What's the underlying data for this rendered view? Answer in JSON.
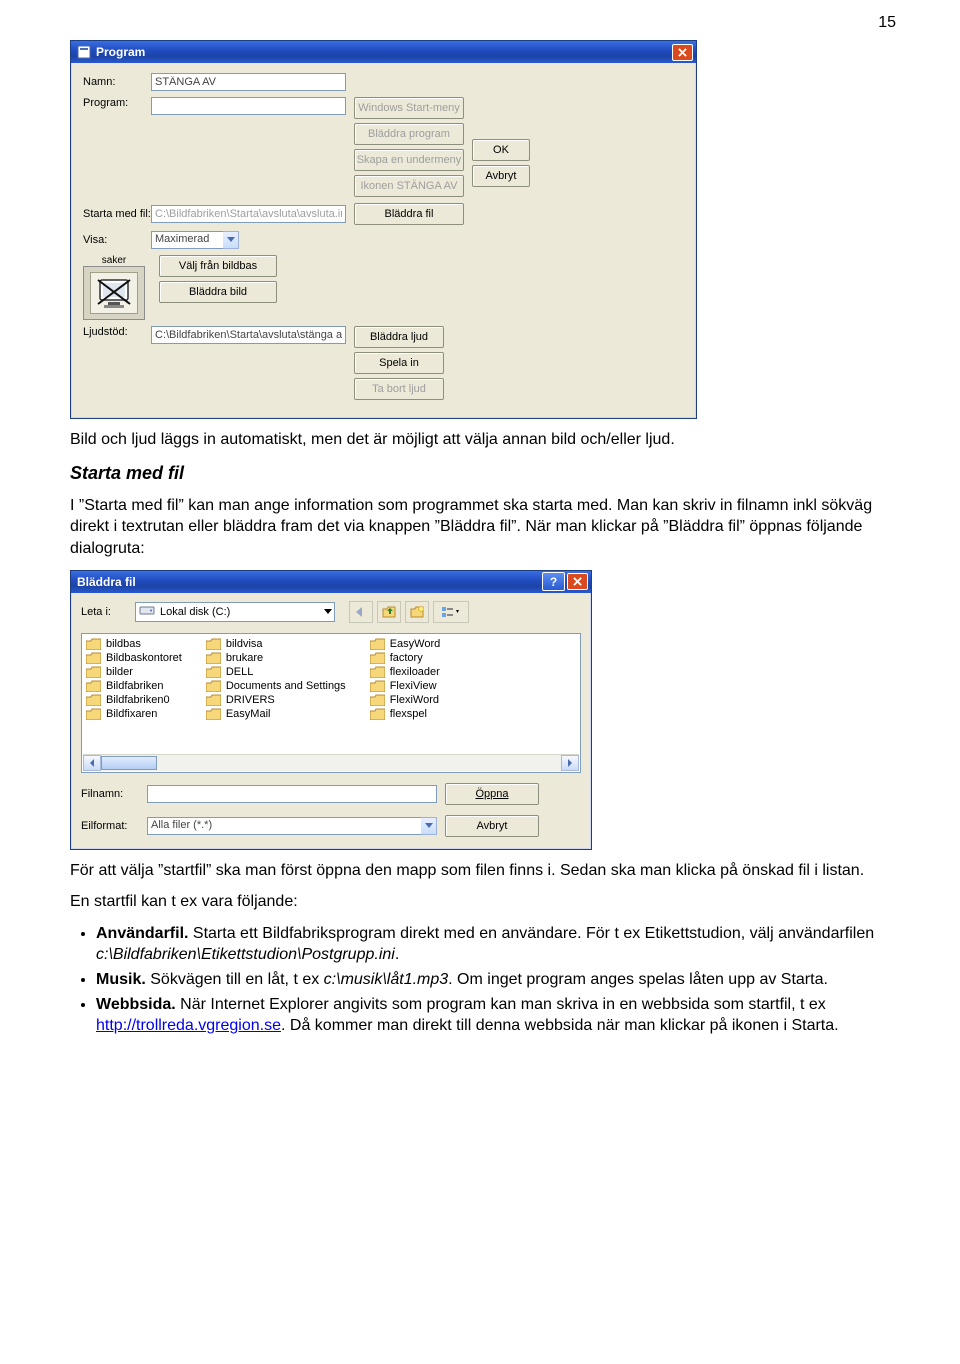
{
  "page_number": "15",
  "program_dialog": {
    "title": "Program",
    "labels": {
      "namn": "Namn:",
      "program": "Program:",
      "starta_med_fil": "Starta med fil:",
      "visa": "Visa:",
      "ljudstod": "Ljudstöd:"
    },
    "values": {
      "namn": "STÄNGA AV",
      "program": "",
      "starta_med_fil": "C:\\Bildfabriken\\Starta\\avsluta\\avsluta.ini",
      "visa": "Maximerad",
      "ljudstod": "C:\\Bildfabriken\\Starta\\avsluta\\stänga av.wav",
      "thumb_caption": "saker"
    },
    "buttons": {
      "windows_start": "Windows Start-meny",
      "bladdra_program": "Bläddra program",
      "skapa_undermeny": "Skapa en undermeny",
      "ikonen": "Ikonen STÄNGA AV",
      "bladdra_fil": "Bläddra fil",
      "valj_fran_bildbas": "Välj från bildbas",
      "bladdra_bild": "Bläddra bild",
      "bladdra_ljud": "Bläddra ljud",
      "spela_in": "Spela in",
      "ta_bort_ljud": "Ta bort ljud",
      "ok": "OK",
      "avbryt": "Avbryt"
    }
  },
  "para1": "Bild och ljud läggs in automatiskt, men det är möjligt att välja annan bild och/eller ljud.",
  "starta_heading": "Starta med fil",
  "para2": "I ”Starta med fil” kan man ange information som programmet ska starta med. Man kan skriv in filnamn inkl sökväg direkt i textrutan eller bläddra fram det via knappen ”Bläddra fil”. När man klickar på ”Bläddra fil” öppnas följande dialogruta:",
  "browse_dialog": {
    "title": "Bläddra fil",
    "letai_label": "Leta i:",
    "drive_label": "Lokal disk (C:)",
    "folders_col1": [
      "bildbas",
      "Bildbaskontoret",
      "bilder",
      "Bildfabriken",
      "Bildfabriken0",
      "Bildfixaren"
    ],
    "folders_col2": [
      "bildvisa",
      "brukare",
      "DELL",
      "Documents and Settings",
      "DRIVERS",
      "EasyMail"
    ],
    "folders_col3": [
      "EasyWord",
      "factory",
      "flexiloader",
      "FlexiView",
      "FlexiWord",
      "flexspel"
    ],
    "filnamn_label": "Filnamn:",
    "filnamn_value": "",
    "filformat_label": "Eilformat:",
    "filformat_value": "Alla filer (*.*)",
    "open_button": "Öppna",
    "cancel_button": "Avbryt"
  },
  "para3": "För att välja ”startfil” ska man först öppna den mapp som filen finns i. Sedan ska man klicka på önskad fil i listan.",
  "para4": "En startfil kan t ex vara följande:",
  "bullets": {
    "a_bold": "Användarfil.",
    "a_rest1": " Starta ett Bildfabriksprogram direkt med en användare. För t ex Etikettstudion, välj användarfilen ",
    "a_path": "c:\\Bildfabriken\\Etikettstudion\\Postgrupp.ini",
    "a_dot": ".",
    "b_bold": "Musik.",
    "b_rest1": " Sökvägen till en låt, t ex ",
    "b_path": "c:\\musik\\låt1.mp3",
    "b_rest2": ". Om inget program anges spelas låten upp av Starta.",
    "c_bold": "Webbsida.",
    "c_rest1": " När Internet Explorer angivits som program kan man skriva in en webbsida som startfil, t ex ",
    "c_link_text": "http://trollreda.vgregion.se",
    "c_link_href": "http://trollreda.vgregion.se",
    "c_rest2": ". Då kommer man direkt till denna webbsida när man klickar på ikonen i Starta."
  }
}
